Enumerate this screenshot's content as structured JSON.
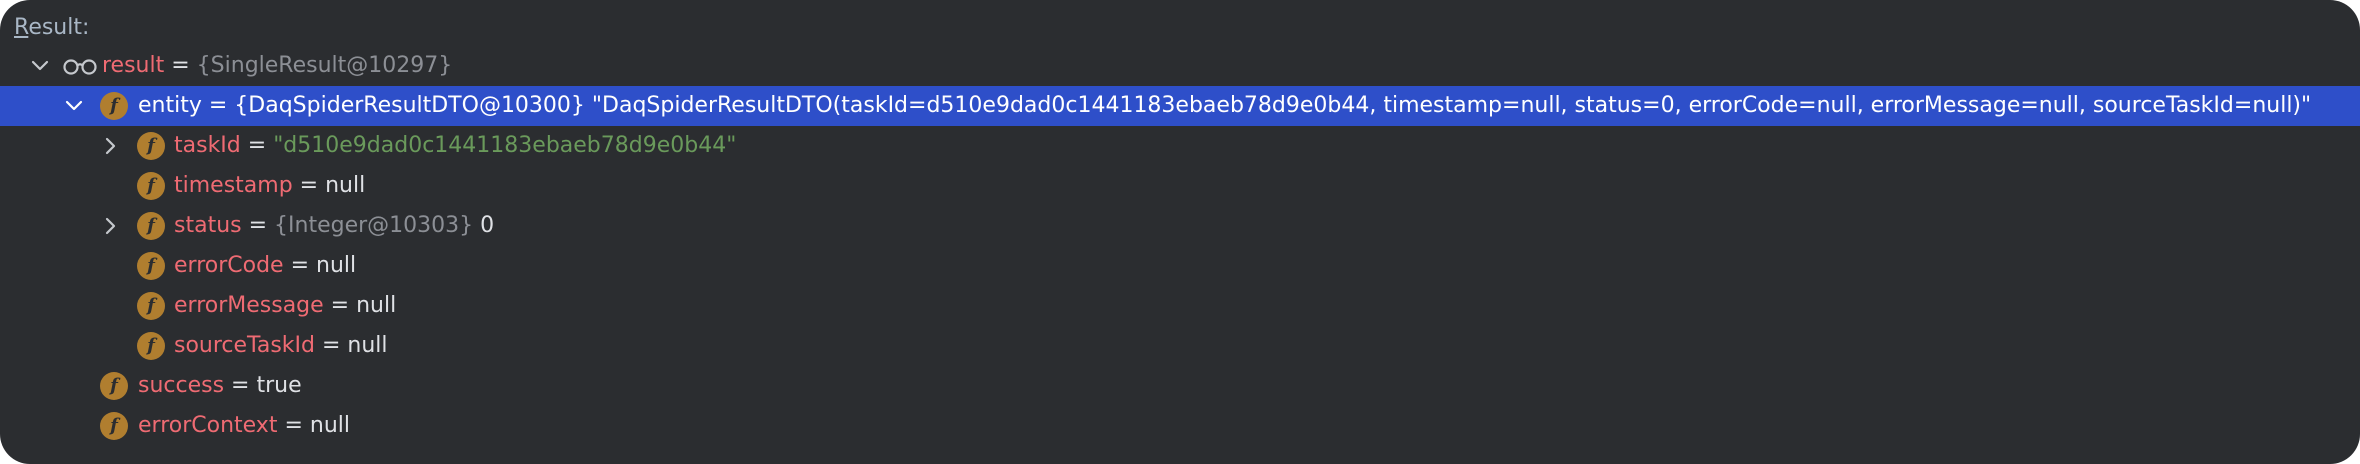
{
  "header": {
    "mnemonic": "R",
    "rest": "esult:"
  },
  "tree": {
    "result": {
      "name": "result",
      "eq": " = ",
      "type": "{SingleResult@10297}"
    },
    "entity": {
      "name": "entity",
      "eq": " = ",
      "type": "{DaqSpiderResultDTO@10300}",
      "value": " \"DaqSpiderResultDTO(taskId=d510e9dad0c1441183ebaeb78d9e0b44, timestamp=null, status=0, errorCode=null, errorMessage=null, sourceTaskId=null)\""
    },
    "taskId": {
      "name": "taskId",
      "eq": " = ",
      "value": "\"d510e9dad0c1441183ebaeb78d9e0b44\""
    },
    "timestamp": {
      "name": "timestamp",
      "eq": " = ",
      "value": "null"
    },
    "status": {
      "name": "status",
      "eq": " = ",
      "type": "{Integer@10303}",
      "value": " 0"
    },
    "errorCode": {
      "name": "errorCode",
      "eq": " = ",
      "value": "null"
    },
    "errorMessage": {
      "name": "errorMessage",
      "eq": " = ",
      "value": "null"
    },
    "sourceTaskId": {
      "name": "sourceTaskId",
      "eq": " = ",
      "value": "null"
    },
    "success": {
      "name": "success",
      "eq": " = ",
      "value": "true"
    },
    "errorContext": {
      "name": "errorContext",
      "eq": " = ",
      "value": "null"
    }
  },
  "icons": {
    "watch": "glasses-icon",
    "field": "f",
    "expanded": "chevron-down-icon",
    "collapsed": "chevron-right-icon"
  },
  "colors": {
    "background": "#2b2d30",
    "selection": "#2e4fc9",
    "field_name": "#ef6b73",
    "string_value": "#6a9a5b",
    "type_text": "#8c8f95",
    "field_badge": "#b07e2f"
  }
}
